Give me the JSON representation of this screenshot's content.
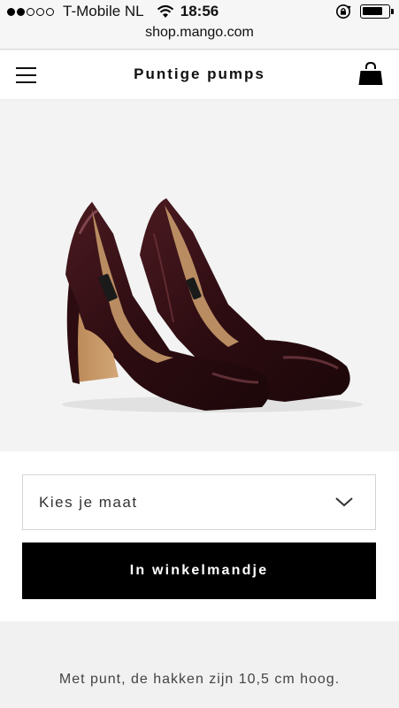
{
  "status_bar": {
    "carrier": "T-Mobile NL",
    "signal_bars_filled": 2,
    "signal_bars_total": 5,
    "time": "18:56",
    "battery_level": 0.8,
    "url": "shop.mango.com"
  },
  "header": {
    "title": "Puntige pumps"
  },
  "product": {
    "image_icon": "patent-pumps-image",
    "colors": {
      "patent": "#3a1217",
      "inner": "#b98c62",
      "background": "#f3f3f3"
    }
  },
  "size_select": {
    "label": "Kies je maat"
  },
  "cart_button": {
    "label": "In winkelmandje"
  },
  "description": {
    "text": "Met punt, de hakken zijn 10,5 cm hoog."
  }
}
